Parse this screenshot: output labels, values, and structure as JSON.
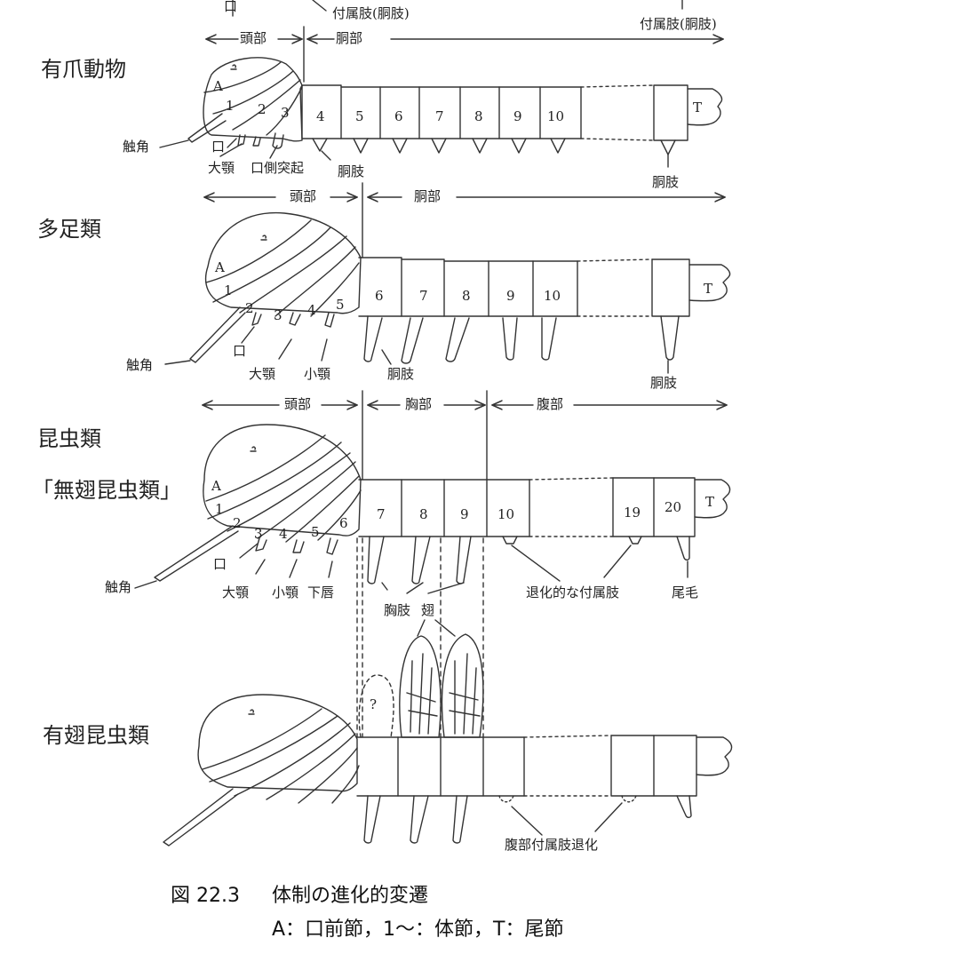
{
  "top_partial": {
    "mouth": "口",
    "limb_left": "付属肢(胴肢)",
    "limb_right": "付属肢(胴肢)"
  },
  "row1": {
    "title": "有爪動物",
    "head": "頭部",
    "trunk": "胴部",
    "acron": "A",
    "telson": "T",
    "seg_numbers": [
      "1",
      "2",
      "3",
      "4",
      "5",
      "6",
      "7",
      "8",
      "9",
      "10"
    ],
    "antenna": "触角",
    "mouth": "口",
    "mandible": "大顎",
    "oral_papilla": "口側突起",
    "limb": "胴肢",
    "limb2": "胴肢"
  },
  "row2": {
    "title": "多足類",
    "head": "頭部",
    "trunk": "胴部",
    "acron": "A",
    "telson": "T",
    "seg_numbers": [
      "1",
      "2",
      "3",
      "4",
      "5",
      "6",
      "7",
      "8",
      "9",
      "10"
    ],
    "antenna": "触角",
    "mouth": "口",
    "mandible": "大顎",
    "maxilla": "小顎",
    "limb": "胴肢",
    "limb2": "胴肢"
  },
  "row3": {
    "title": "昆虫類",
    "subtitle": "「無翅昆虫類」",
    "head": "頭部",
    "thorax": "胸部",
    "abdomen": "腹部",
    "acron": "A",
    "telson": "T",
    "seg_numbers": [
      "1",
      "2",
      "3",
      "4",
      "5",
      "6",
      "7",
      "8",
      "9",
      "10",
      "19",
      "20"
    ],
    "antenna": "触角",
    "mouth": "口",
    "mandible": "大顎",
    "maxilla": "小顎",
    "labium": "下唇",
    "thoracic_legs": "胸肢",
    "wing": "翅",
    "vestigial": "退化的な付属肢",
    "cercus": "尾毛"
  },
  "row4": {
    "title": "有翅昆虫類",
    "question": "?",
    "abdominal_reduced": "腹部付属肢退化"
  },
  "caption": {
    "figure": "図 22.3",
    "title": "体制の進化的変遷",
    "legend": "A：口前節，1〜：体節，T：尾節"
  }
}
